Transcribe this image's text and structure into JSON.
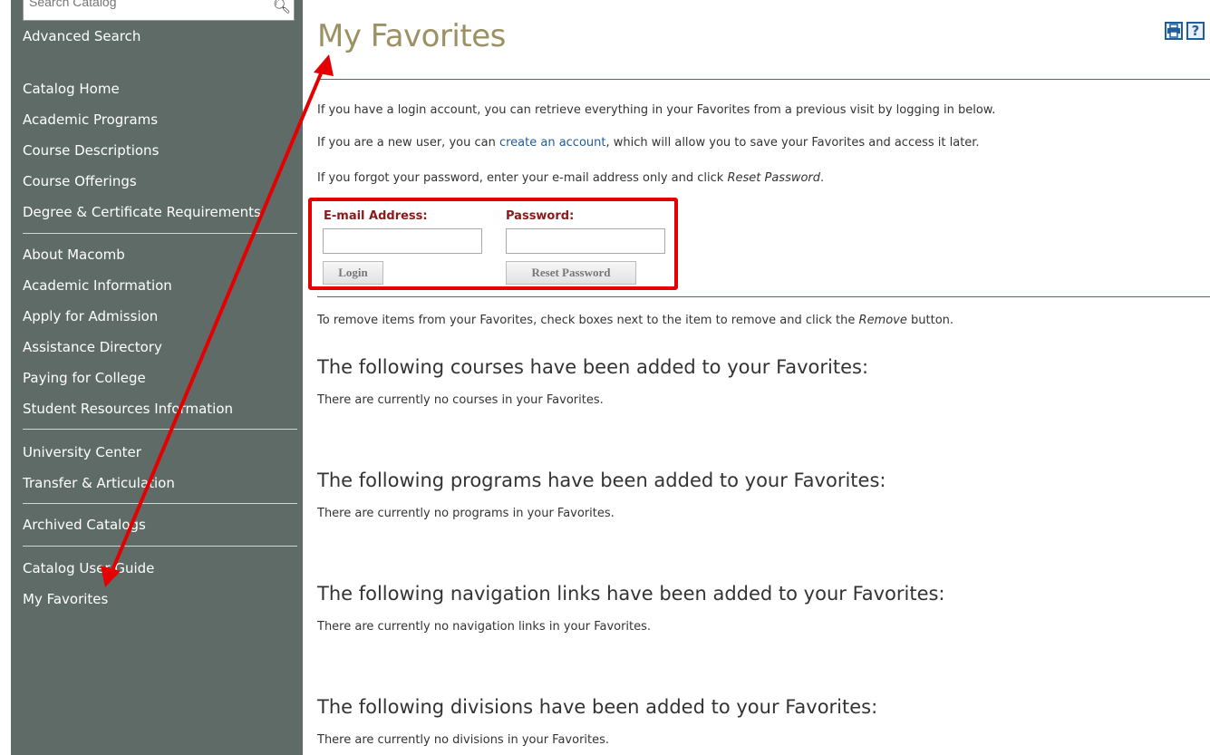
{
  "sidebar": {
    "search_placeholder": "Search Catalog",
    "advanced_search": "Advanced Search",
    "group1": [
      "Catalog Home",
      "Academic Programs",
      "Course Descriptions",
      "Course Offerings",
      "Degree & Certificate Requirements"
    ],
    "group2": [
      "About Macomb",
      "Academic Information",
      "Apply for Admission",
      "Assistance Directory",
      "Paying for College",
      "Student Resources Information"
    ],
    "group3": [
      "University Center",
      "Transfer & Articulation"
    ],
    "group4": [
      "Archived Catalogs"
    ],
    "group5": [
      "Catalog User Guide",
      "My Favorites"
    ]
  },
  "main": {
    "title": "My Favorites",
    "icons": [
      "print-icon",
      "help-icon"
    ],
    "help_glyph": "?",
    "intro1": "If you have a login account, you can retrieve everything in your Favorites from a previous visit by logging in below.",
    "intro2_pre": "If you are a new user, you can ",
    "intro2_link": "create an account",
    "intro2_post": ", which will allow you to save your Favorites and access it later.",
    "intro3_pre": "If you forgot your password, enter your e-mail address only and click ",
    "intro3_em": "Reset Password",
    "intro3_post": ".",
    "login_form": {
      "email_label": "E-mail Address:",
      "email_value": "",
      "password_label": "Password:",
      "password_value": "",
      "login_button": "Login",
      "reset_button": "Reset Password"
    },
    "remove_pre": "To remove items from your Favorites, check boxes next to the item to remove and click the ",
    "remove_em": "Remove",
    "remove_post": " button.",
    "sections": [
      {
        "heading": "The following courses have been added to your Favorites:",
        "empty": "There are currently no courses in your Favorites."
      },
      {
        "heading": "The following programs have been added to your Favorites:",
        "empty": "There are currently no programs in your Favorites."
      },
      {
        "heading": "The following navigation links have been added to your Favorites:",
        "empty": "There are currently no navigation links in your Favorites."
      },
      {
        "heading": "The following divisions have been added to your Favorites:",
        "empty": "There are currently no divisions in your Favorites."
      }
    ]
  },
  "colors": {
    "sidebar_bg": "#5e6b67",
    "title": "#9c9164",
    "label": "#8c1a1a",
    "link": "#1f5c99",
    "annotation_red": "#e40000"
  }
}
